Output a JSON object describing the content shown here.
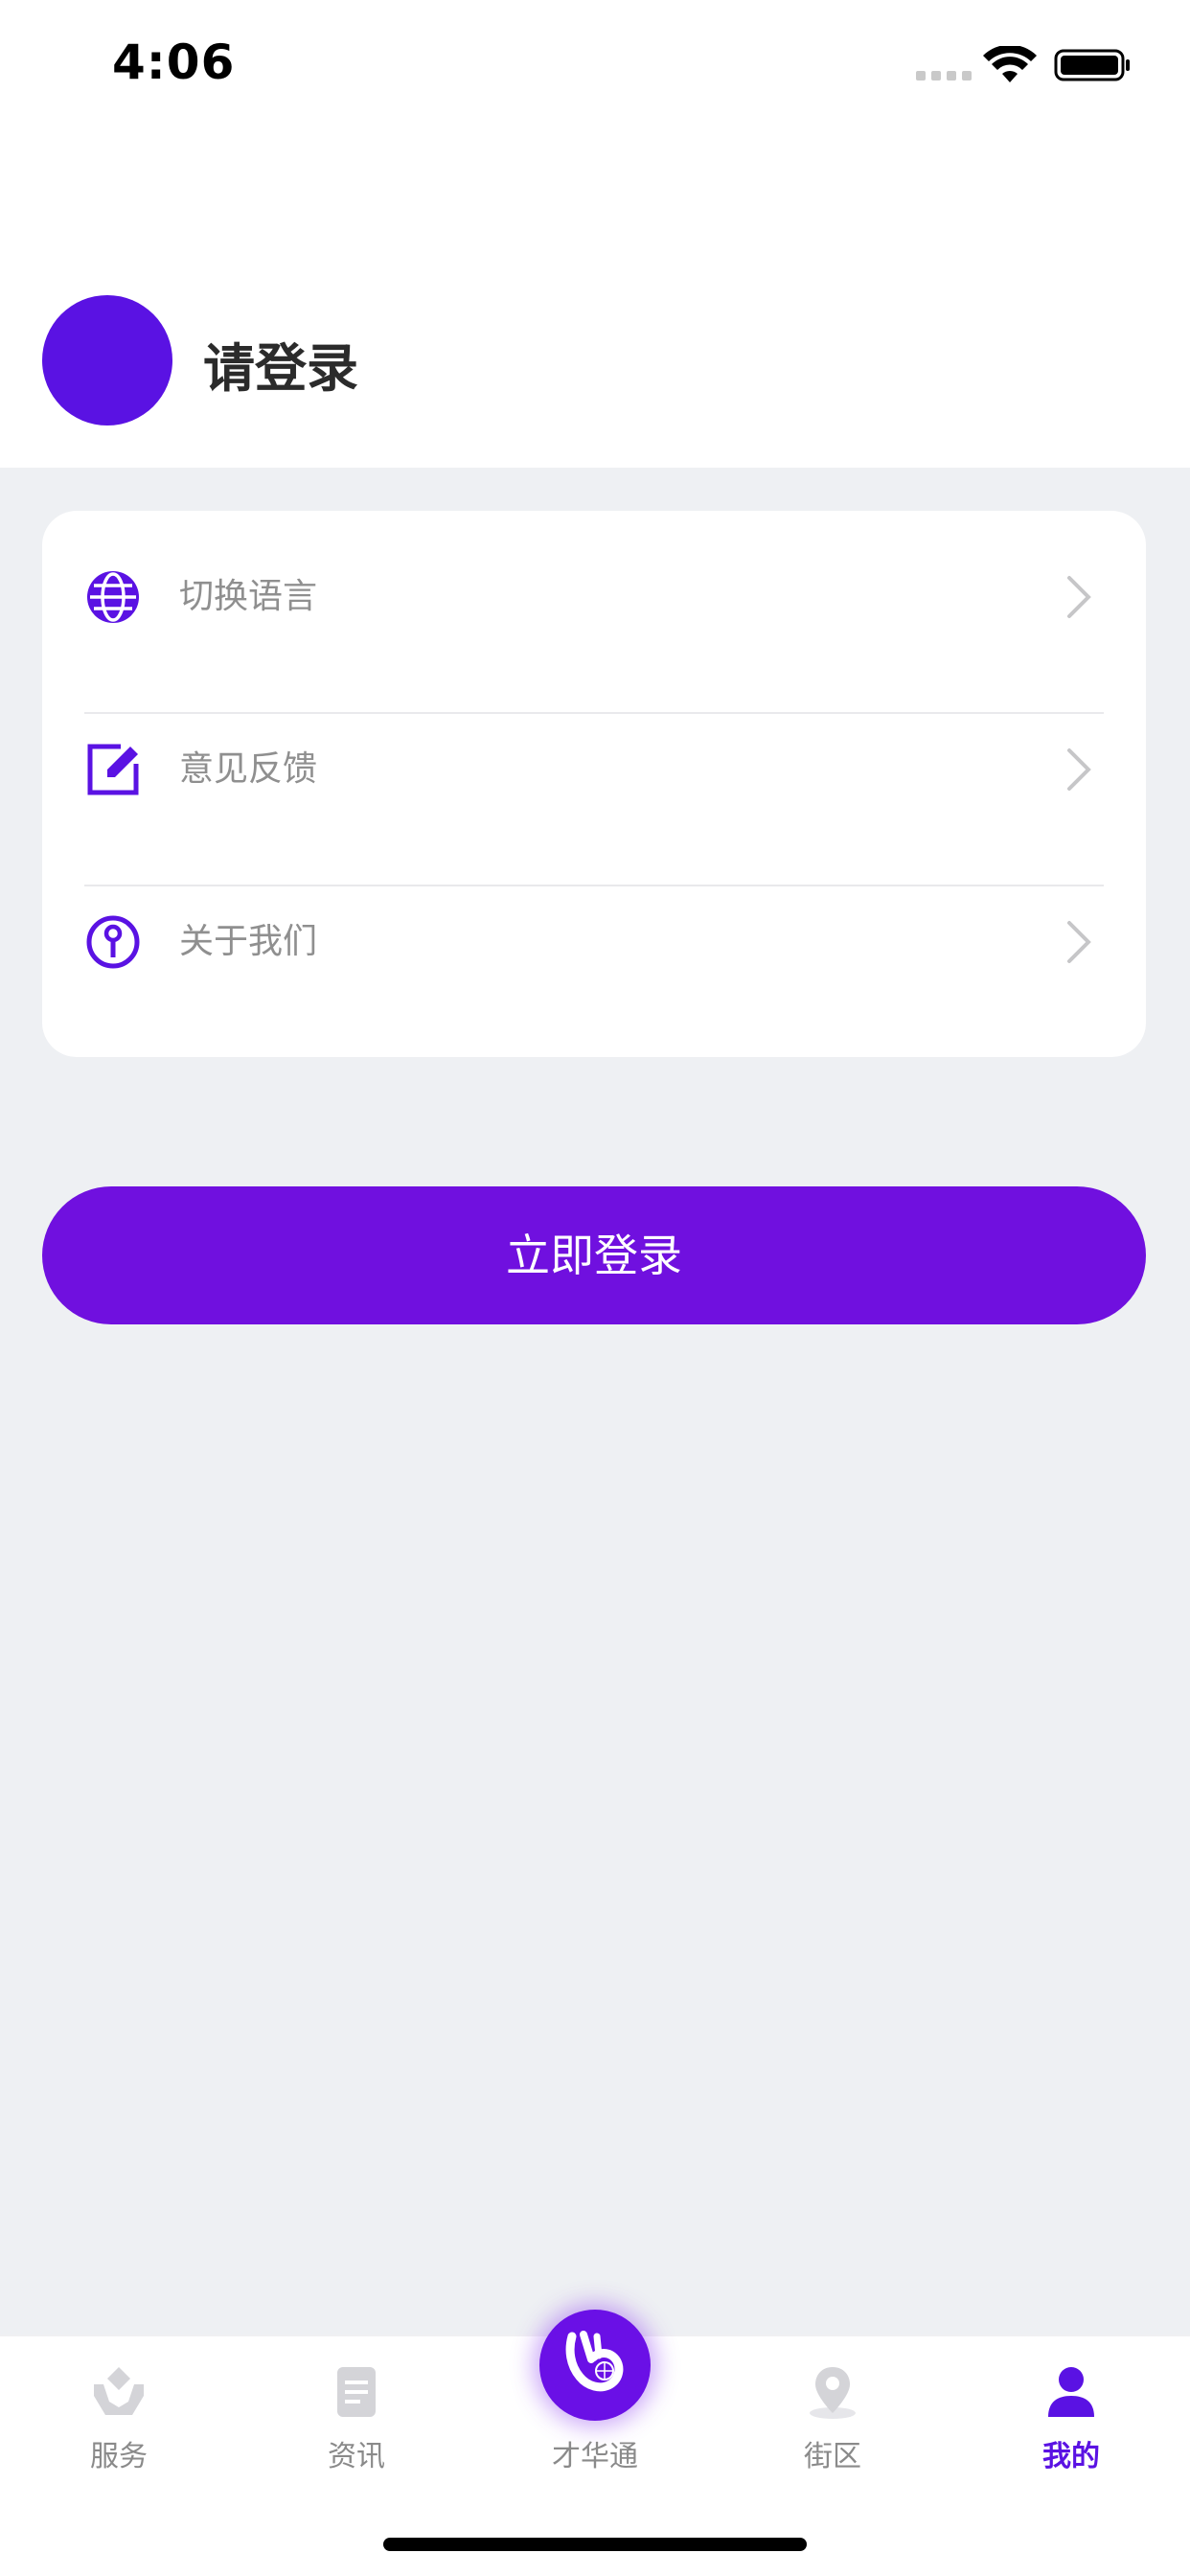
{
  "status_bar": {
    "time": "4:06"
  },
  "profile": {
    "login_prompt": "请登录"
  },
  "menu": {
    "items": [
      {
        "label": "切换语言",
        "icon": "globe-icon"
      },
      {
        "label": "意见反馈",
        "icon": "edit-icon"
      },
      {
        "label": "关于我们",
        "icon": "info-icon"
      }
    ]
  },
  "login_button": {
    "label": "立即登录"
  },
  "tab_bar": {
    "tabs": [
      {
        "label": "服务",
        "icon": "service-icon",
        "active": false
      },
      {
        "label": "资讯",
        "icon": "news-icon",
        "active": false
      },
      {
        "label": "才华通",
        "icon": "ok-hand-icon",
        "active": false
      },
      {
        "label": "街区",
        "icon": "location-icon",
        "active": false
      },
      {
        "label": "我的",
        "icon": "user-icon",
        "active": true
      }
    ]
  },
  "colors": {
    "accent": "#5a12e3",
    "button": "#7010df",
    "background": "#eef0f3",
    "inactive_tab": "#8a8a8a"
  }
}
